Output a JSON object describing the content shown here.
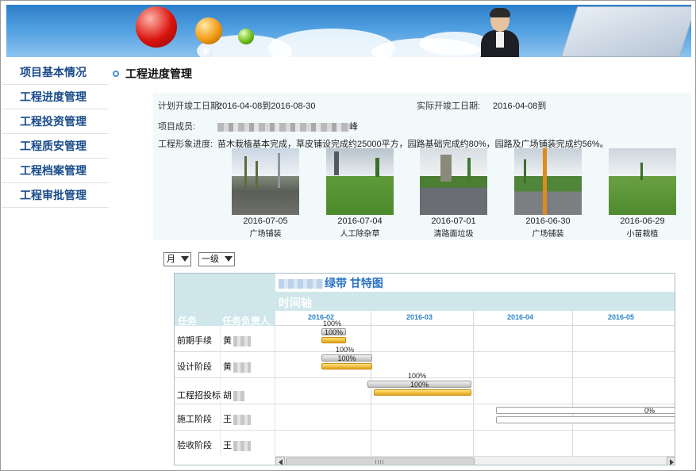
{
  "sidebar": {
    "items": [
      {
        "label": "项目基本情况"
      },
      {
        "label": "工程进度管理"
      },
      {
        "label": "工程投资管理"
      },
      {
        "label": "工程质安管理"
      },
      {
        "label": "工程档案管理"
      },
      {
        "label": "工程审批管理"
      }
    ]
  },
  "page": {
    "title": "工程进度管理"
  },
  "info": {
    "plan_label": "计划开竣工日期:",
    "plan_value": "2016-04-08到2016-08-30",
    "actual_label": "实际开竣工日期:",
    "actual_value": "2016-04-08到",
    "members_label": "项目成员:",
    "members_tail": "峰",
    "progress_label": "工程形象进度:",
    "progress_value": "苗木栽植基本完成，草皮铺设完成约25000平方，园路基础完成约80%，园路及广场铺装完成约56%。"
  },
  "photos": [
    {
      "date": "2016-07-05",
      "caption": "广场铺装"
    },
    {
      "date": "2016-07-04",
      "caption": "人工除杂草"
    },
    {
      "date": "2016-07-01",
      "caption": "清路面垃圾"
    },
    {
      "date": "2016-06-30",
      "caption": "广场铺装"
    },
    {
      "date": "2016-06-29",
      "caption": "小苗栽植"
    }
  ],
  "controls": {
    "period_select": "月",
    "level_select": "一级"
  },
  "gantt": {
    "title_suffix": "绿带  甘特图",
    "axis_label": "时间轴",
    "col_task": "任务",
    "col_owner": "任务负责人",
    "months": [
      "2016-02",
      "2016-03",
      "2016-04",
      "2016-05"
    ],
    "rows": [
      {
        "task": "前期手续",
        "owner_initial": "黄",
        "plan_pct": "100%",
        "actual_pct": "100%"
      },
      {
        "task": "设计阶段",
        "owner_initial": "黄",
        "plan_pct": "100%",
        "actual_pct": "100%"
      },
      {
        "task": "工程招投标",
        "owner_initial": "胡",
        "plan_pct": "100%",
        "actual_pct": "100%"
      },
      {
        "task": "施工阶段",
        "owner_initial": "王",
        "plan_pct": "0%",
        "actual_pct": ""
      },
      {
        "task": "验收阶段",
        "owner_initial": "王",
        "plan_pct": "",
        "actual_pct": ""
      }
    ]
  },
  "colors": {
    "sidebar_text": "#1a4b8a",
    "header_fill": "#cfe7ea",
    "month_text": "#2a84c9",
    "bar_actual": "#e1a218"
  }
}
